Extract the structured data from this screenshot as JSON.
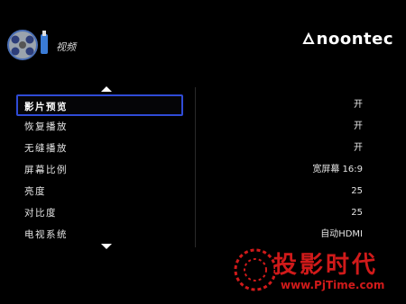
{
  "header": {
    "title": "视频"
  },
  "brand": {
    "name": "noontec"
  },
  "menu": {
    "items": [
      {
        "label": "影片预览",
        "value": "开",
        "selected": true
      },
      {
        "label": "恢复播放",
        "value": "开"
      },
      {
        "label": "无缝播放",
        "value": "开"
      },
      {
        "label": "屏幕比例",
        "value": "宽屏幕 16:9"
      },
      {
        "label": "亮度",
        "value": "25"
      },
      {
        "label": "对比度",
        "value": "25"
      },
      {
        "label": "电视系统",
        "value": "自动HDMI"
      }
    ]
  },
  "watermark": {
    "text": "投影时代",
    "url": "www.PjTime.com"
  },
  "colors": {
    "selection_border": "#2f4bd6",
    "watermark": "#d01a1a",
    "background": "#000000"
  }
}
